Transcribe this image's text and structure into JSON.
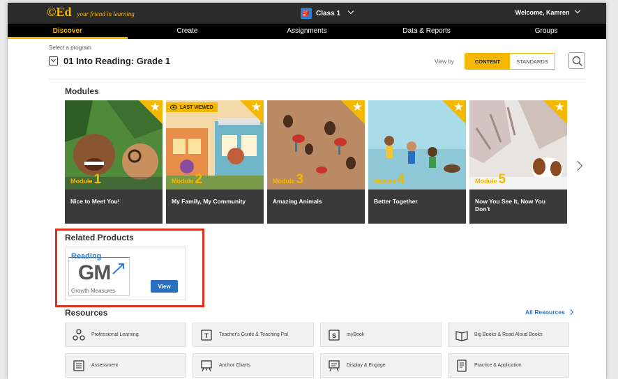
{
  "header": {
    "logo": "©Ed",
    "tagline": "your friend in learning",
    "class_label": "Class 1",
    "class_icon_glyph": "🎒",
    "welcome": "Welcome, Kamren"
  },
  "nav": [
    "Discover",
    "Create",
    "Assignments",
    "Data & Reports",
    "Groups"
  ],
  "program": {
    "select_label": "Select a program",
    "name": "01 Into Reading: Grade 1"
  },
  "view_by": {
    "label": "View by",
    "content": "CONTENT",
    "standards": "STANDARDS"
  },
  "modules": {
    "title": "Modules",
    "module_word": "Module",
    "last_viewed": "LAST VIEWED",
    "items": [
      {
        "num": "1",
        "title": "Nice to Meet You!"
      },
      {
        "num": "2",
        "title": "My Family, My Community"
      },
      {
        "num": "3",
        "title": "Amazing Animals"
      },
      {
        "num": "4",
        "title": "Better Together"
      },
      {
        "num": "5",
        "title": "Now You See It, Now You Don't"
      }
    ]
  },
  "related": {
    "title": "Related Products",
    "product_top": "Reading",
    "product_logo": "GM",
    "product_sub": "Growth Measures",
    "view_button": "View"
  },
  "resources": {
    "title": "Resources",
    "all_link": "All Resources",
    "items": [
      {
        "label": "Professional Learning",
        "icon": "people-network-icon"
      },
      {
        "label": "Teacher's Guide & Teaching Pal",
        "icon": "guide-book-icon"
      },
      {
        "label": "myBook",
        "icon": "mybook-icon"
      },
      {
        "label": "Big Books & Read Aloud Books",
        "icon": "open-book-icon"
      },
      {
        "label": "Assessment",
        "icon": "checklist-icon"
      },
      {
        "label": "Anchor Charts",
        "icon": "easel-chart-icon"
      },
      {
        "label": "Display & Engage",
        "icon": "display-easel-icon"
      },
      {
        "label": "Practice & Application",
        "icon": "worksheet-icon"
      }
    ]
  },
  "colors": {
    "accent": "#f5b800",
    "nav_bg": "#000000",
    "link_blue": "#2a6fc0",
    "highlight_red": "#e0331e"
  }
}
